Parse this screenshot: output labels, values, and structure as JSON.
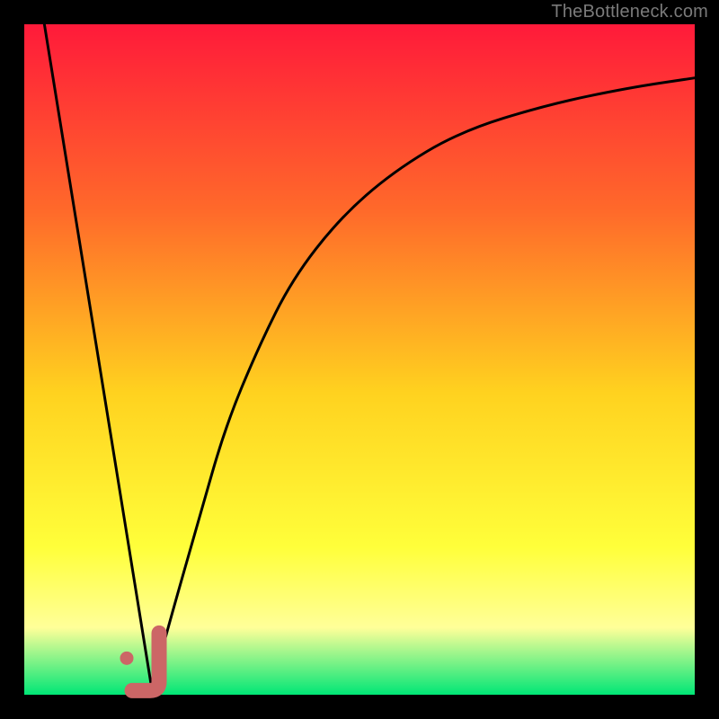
{
  "watermark": {
    "text": "TheBottleneck.com"
  },
  "colors": {
    "black": "#000000",
    "curve": "#000000",
    "marker_fill": "#cc6666",
    "marker_stroke": "#b24f4f",
    "grad_top": "#ff1a3a",
    "grad_mid1": "#ff6a2a",
    "grad_mid2": "#ffd21f",
    "grad_mid3": "#ffff3a",
    "grad_pale": "#ffff99",
    "grad_bottom": "#00e676"
  },
  "chart_data": {
    "type": "line",
    "title": "",
    "xlabel": "",
    "ylabel": "",
    "xlim": [
      0,
      100
    ],
    "ylim": [
      0,
      100
    ],
    "series": [
      {
        "name": "left-line",
        "x": [
          3,
          19
        ],
        "values": [
          100,
          1
        ]
      },
      {
        "name": "right-curve",
        "x": [
          19,
          22,
          26,
          30,
          35,
          40,
          47,
          55,
          65,
          78,
          90,
          100
        ],
        "values": [
          1,
          12,
          26,
          40,
          52,
          62,
          71,
          78,
          84,
          88,
          90.5,
          92
        ]
      }
    ],
    "marker": {
      "name": "j-marker",
      "x": 18.5,
      "y": 2.5
    }
  }
}
